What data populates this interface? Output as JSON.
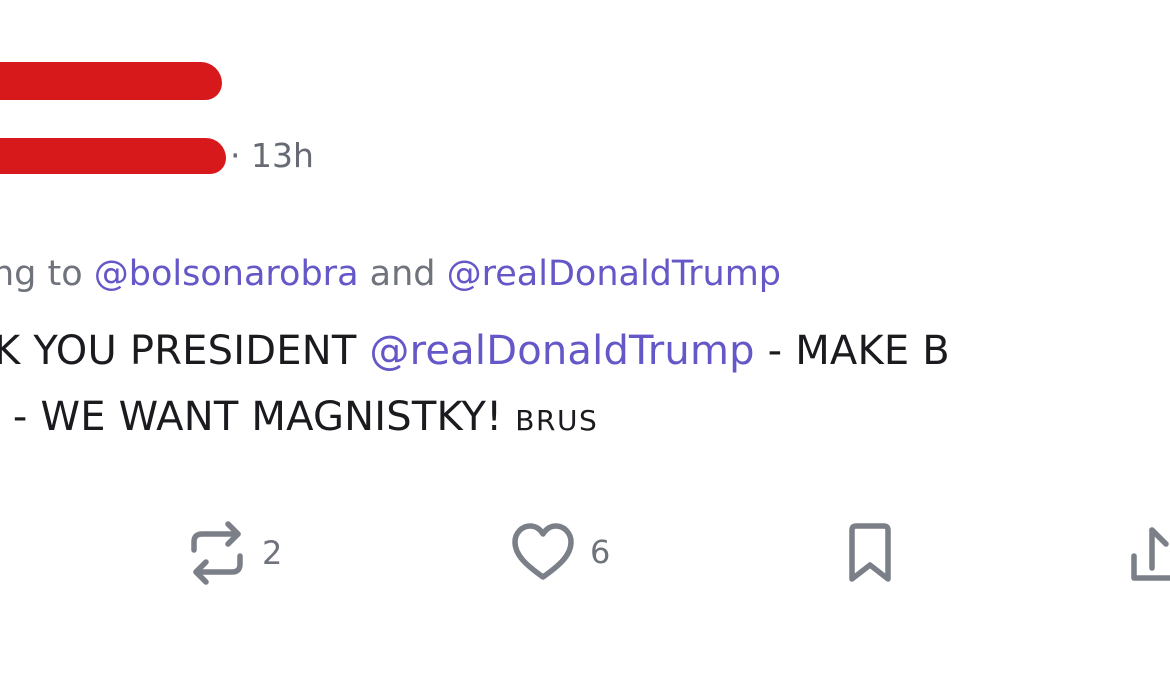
{
  "post": {
    "timestamp": "· 13h",
    "replying_prefix": "ng to ",
    "replying_mention_1": "@bolsonarobra",
    "replying_and": " and ",
    "replying_mention_2": "@realDonaldTrump",
    "line1_start": "K YOU PRESIDENT ",
    "line1_mention": "@realDonaldTrump",
    "line1_end": " - MAKE B",
    "line2_text": "I - WE WANT MAGNISTKY! ",
    "line2_tag": "BRUS"
  },
  "actions": {
    "repost_count": "2",
    "like_count": "6",
    "repost_icon": "repost-icon",
    "like_icon": "heart-icon",
    "bookmark_icon": "bookmark-icon",
    "share_icon": "share-icon"
  },
  "colors": {
    "redaction": "#d8191c",
    "mention": "#6457c8",
    "muted": "#6f737c"
  }
}
